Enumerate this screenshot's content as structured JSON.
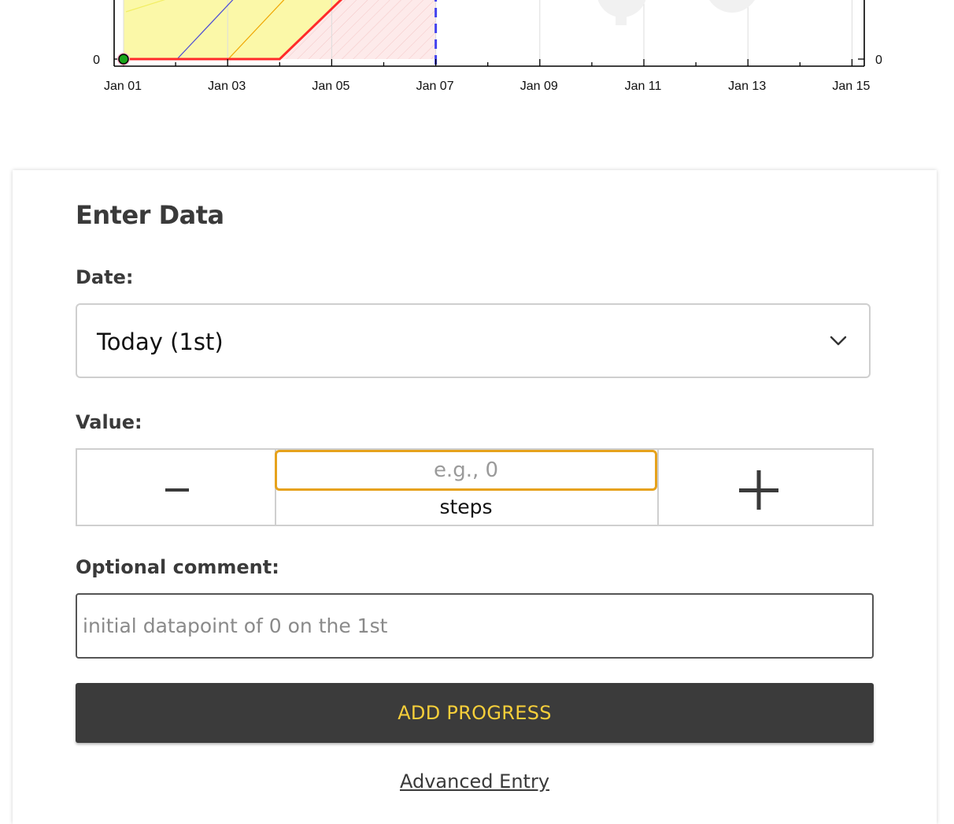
{
  "chart_data": {
    "type": "line",
    "x_ticks": [
      "Jan 01",
      "Jan 03",
      "Jan 05",
      "Jan 07",
      "Jan 09",
      "Jan 11",
      "Jan 13",
      "Jan 15"
    ],
    "y_ticks_left": [
      "0"
    ],
    "y_ticks_right": [
      "0"
    ],
    "xlim": [
      "Dec 31",
      "Jan 15"
    ],
    "grid": true,
    "series": [
      {
        "values": [
          {
            "x": "Jan 01",
            "y": 0
          },
          {
            "x": "Jan 04",
            "y": 0
          }
        ]
      }
    ],
    "datapoints": [
      {
        "x": "Jan 01",
        "y": 0
      }
    ],
    "today_marker": "Jan 07",
    "colors": {
      "road": "#ff2a2a",
      "yellow_band": "#fbf8a8",
      "datapoint": "#1aa51a",
      "today_line": "#4444ee",
      "red_zone": "#fdeaea",
      "grid": "#dddddd"
    }
  },
  "form": {
    "title": "Enter Data",
    "date_label": "Date:",
    "date_value": "Today (1st)",
    "value_label": "Value:",
    "minus_label": "−",
    "plus_label": "+",
    "value_placeholder": "e.g., 0",
    "units": "steps",
    "comment_label": "Optional comment:",
    "comment_placeholder": "initial datapoint of 0 on the 1st",
    "submit_label": "ADD PROGRESS",
    "advanced_link": "Advanced Entry"
  },
  "icons": {
    "date_dropdown": "chevron-down-icon"
  }
}
